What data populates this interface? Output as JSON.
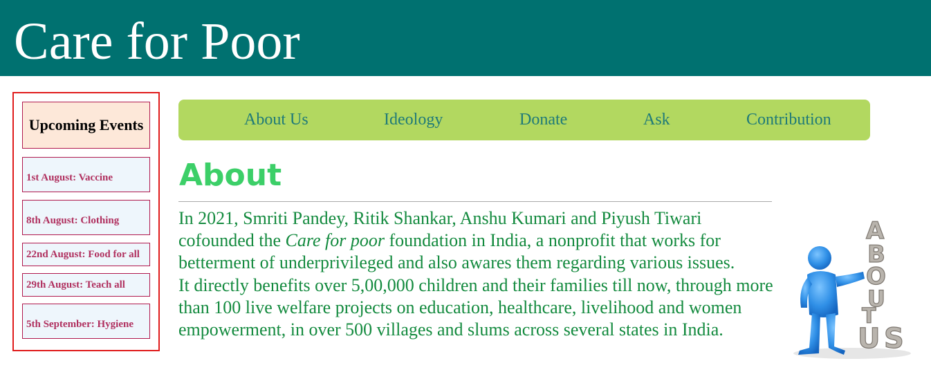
{
  "header": {
    "title": "Care for Poor",
    "background_color": "#007170"
  },
  "sidebar": {
    "heading": "Upcoming Events",
    "border_color": "#e01b1b",
    "events": [
      "1st August: Vaccine",
      "8th August: Clothing",
      "22nd August: Food for all",
      "29th August: Teach all",
      "5th September: Hygiene"
    ]
  },
  "nav": {
    "background_color": "#b2d860",
    "items": [
      "About Us",
      "Ideology",
      "Donate",
      "Ask",
      "Contribution"
    ]
  },
  "about": {
    "title": "About",
    "title_color": "#3ccf68",
    "text_color": "#138a3e",
    "paragraph1_before": "In 2021, Smriti Pandey, Ritik Shankar, Anshu Kumari and Piyush Tiwari cofounded the ",
    "paragraph1_emphasis": "Care for poor",
    "paragraph1_after": " foundation in India, a nonprofit that works for betterment of underprivileged and also awares them regarding various issues.",
    "paragraph2": "It directly benefits over 5,00,000 children and their families till now, through more than 100 live welfare projects on education, healthcare, livelihood and women empowerment, in over 500 villages and slums across several states in India.",
    "illustration": {
      "icon": "about-us-3d-figure-icon",
      "letters": [
        "A",
        "B",
        "O",
        "U",
        "T",
        "U",
        "S"
      ]
    }
  }
}
